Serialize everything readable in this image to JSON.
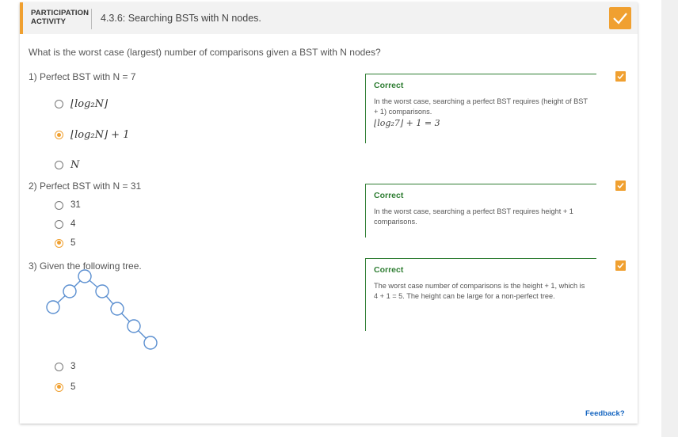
{
  "header": {
    "participation_line1": "PARTICIPATION",
    "participation_line2": "ACTIVITY",
    "title": "4.3.6: Searching BSTs with N nodes."
  },
  "question": "What is the worst case (largest) number of comparisons given a BST with N nodes?",
  "q1": {
    "label": "1)  Perfect BST with N = 7",
    "options": [
      {
        "text": "⌊log₂N⌋",
        "selected": false
      },
      {
        "text": "⌊log₂N⌋ + 1",
        "selected": true
      },
      {
        "text": "N",
        "selected": false
      }
    ],
    "feedback_title": "Correct",
    "feedback_text": "In the worst case, searching a perfect BST requires (height of BST + 1) comparisons.",
    "feedback_math": "⌊log₂7⌋ + 1 = 3"
  },
  "q2": {
    "label": "2)  Perfect BST with N = 31",
    "options": [
      {
        "text": "31",
        "selected": false
      },
      {
        "text": "4",
        "selected": false
      },
      {
        "text": "5",
        "selected": true
      }
    ],
    "feedback_title": "Correct",
    "feedback_text": "In the worst case, searching a perfect BST requires height + 1 comparisons."
  },
  "q3": {
    "label": "3)  Given the following tree.",
    "options": [
      {
        "text": "3",
        "selected": false
      },
      {
        "text": "5",
        "selected": true
      }
    ],
    "feedback_title": "Correct",
    "feedback_text": "The worst case number of comparisons is the height + 1, which is 4 + 1 = 5. The height can be large for a non-perfect tree."
  },
  "feedback_link": "Feedback?",
  "colors": {
    "accent": "#f0a030",
    "correct": "#2e7d32",
    "node": "#5b8fd0",
    "link": "#1565c0"
  }
}
